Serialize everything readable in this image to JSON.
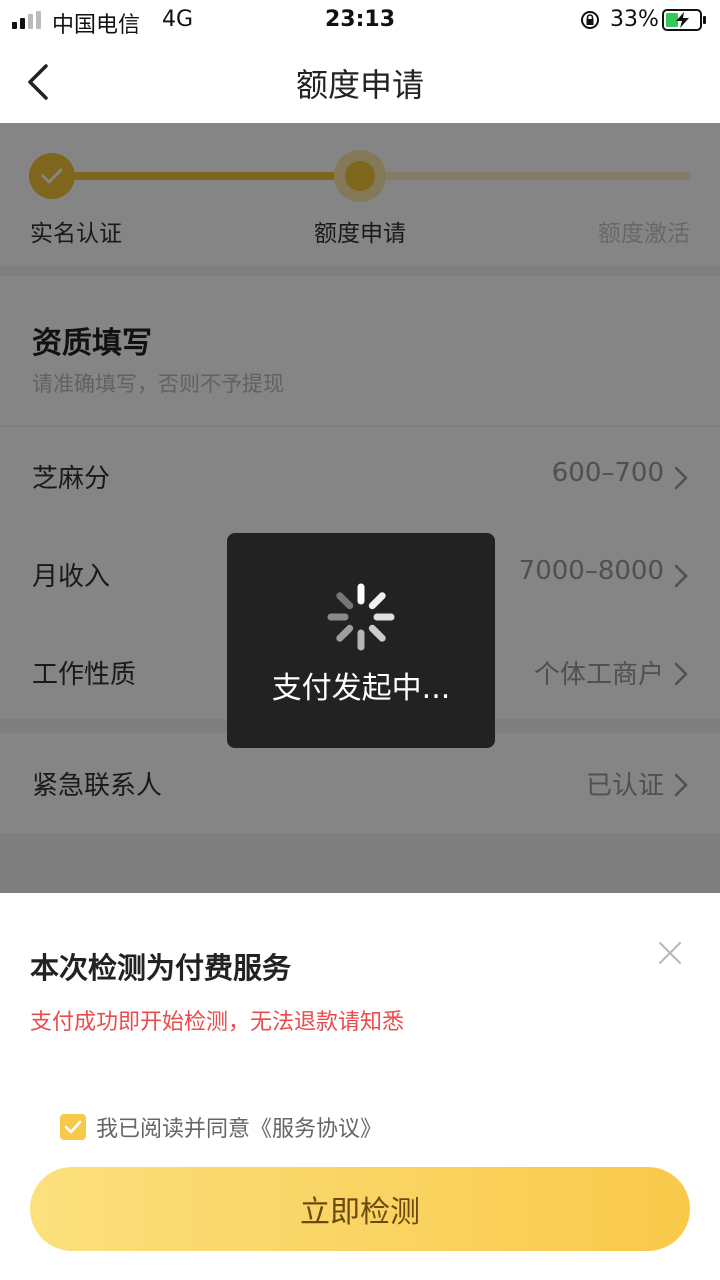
{
  "status_bar": {
    "carrier": "中国电信",
    "network": "4G",
    "time": "23:13",
    "battery": "33%"
  },
  "nav": {
    "title": "额度申请",
    "back_icon": "back-chevron-icon"
  },
  "steps": [
    {
      "label": "实名认证",
      "state": "done"
    },
    {
      "label": "额度申请",
      "state": "current"
    },
    {
      "label": "额度激活",
      "state": "pending"
    }
  ],
  "section": {
    "title": "资质填写",
    "subtitle": "请准确填写，否则不予提现"
  },
  "rows": [
    {
      "label": "芝麻分",
      "value": "600–700"
    },
    {
      "label": "月收入",
      "value": "7000–8000"
    },
    {
      "label": "工作性质",
      "value": "个体工商户"
    }
  ],
  "contact": {
    "label": "紧急联系人",
    "value": "已认证"
  },
  "toast": {
    "text": "支付发起中..."
  },
  "sheet": {
    "title": "本次检测为付费服务",
    "warning": "支付成功即开始检测，无法退款请知悉",
    "agree_text": "我已阅读并同意《服务协议》",
    "agree_checked": true,
    "button_label": "立即检测"
  },
  "colors": {
    "accent": "#f3c338",
    "warning": "#ec4b4b",
    "button_text": "#6b4a10"
  }
}
